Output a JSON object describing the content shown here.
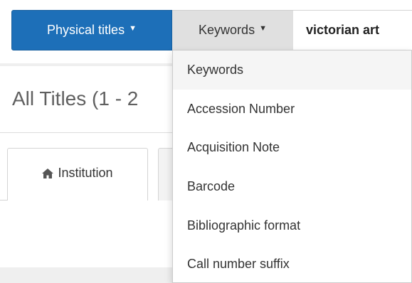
{
  "search": {
    "scope_label": "Physical titles",
    "field_label": "Keywords",
    "query_value": "victorian art"
  },
  "page": {
    "title": "All Titles (1 - 2"
  },
  "tabs": [
    {
      "label": "Institution",
      "icon": "home-icon"
    },
    {
      "label": ""
    }
  ],
  "field_menu": {
    "items": [
      {
        "label": "Keywords",
        "selected": true
      },
      {
        "label": "Accession Number",
        "selected": false
      },
      {
        "label": "Acquisition Note",
        "selected": false
      },
      {
        "label": "Barcode",
        "selected": false
      },
      {
        "label": "Bibliographic format",
        "selected": false
      },
      {
        "label": "Call number suffix",
        "selected": false
      }
    ]
  },
  "colors": {
    "scope_button_bg": "#1d6fb8",
    "field_button_bg": "#e0e0e0",
    "menu_hover_bg": "#f5f5f5"
  }
}
